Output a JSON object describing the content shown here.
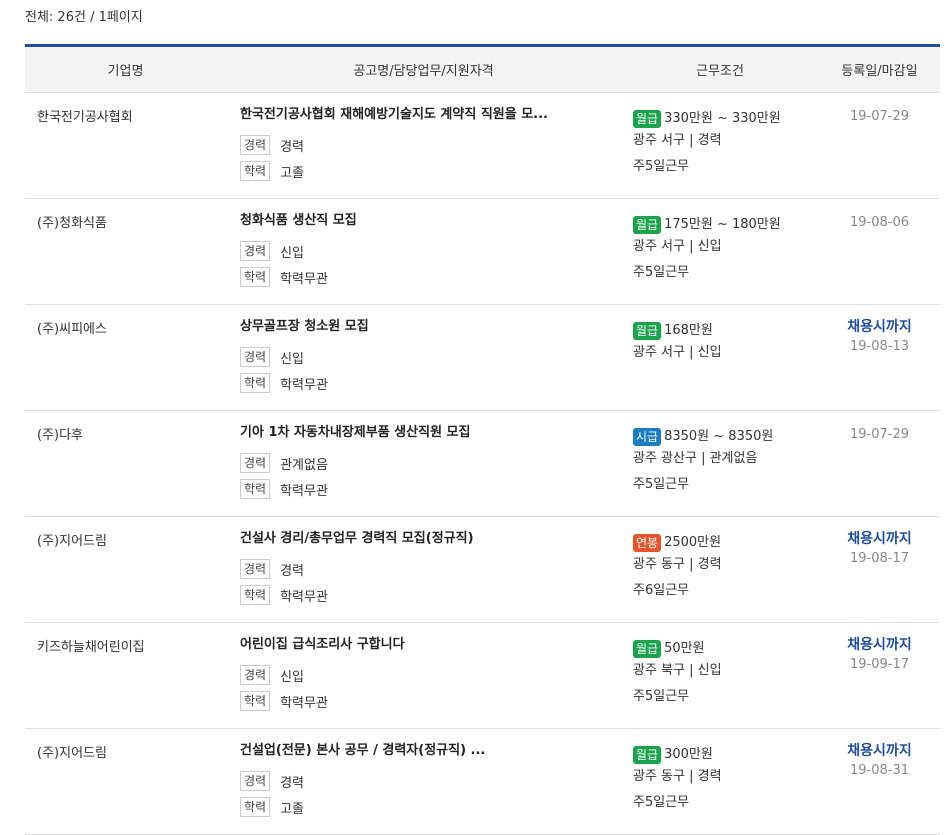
{
  "summary": "전체: 26건 / 1페이지",
  "headers": {
    "company": "기업명",
    "job": "공고명/담당업무/지원자격",
    "conditions": "근무조건",
    "date": "등록일/마감일"
  },
  "labels": {
    "career": "경력",
    "education": "학력"
  },
  "pay_colors": {
    "월급": "#1aa34a",
    "시급": "#1b7cc1",
    "연봉": "#e8552b"
  },
  "rows": [
    {
      "company": "한국전기공사협회",
      "title": "한국전기공사협회 재해예방기술지도 계약직 직원을 모...",
      "career": "경력",
      "education": "고졸",
      "pay_type": "월급",
      "pay_color": "#1aa34a",
      "pay": "330만원 ~ 330만원",
      "location": "광주 서구 | 경력",
      "schedule": "주5일근무",
      "deadline": "",
      "date": "19-07-29"
    },
    {
      "company": "(주)청화식품",
      "title": "청화식품 생산직 모집",
      "career": "신입",
      "education": "학력무관",
      "pay_type": "월급",
      "pay_color": "#1aa34a",
      "pay": "175만원 ~ 180만원",
      "location": "광주 서구 | 신입",
      "schedule": "주5일근무",
      "deadline": "",
      "date": "19-08-06"
    },
    {
      "company": "(주)씨피에스",
      "title": "상무골프장 청소원 모집",
      "career": "신입",
      "education": "학력무관",
      "pay_type": "월급",
      "pay_color": "#1aa34a",
      "pay": "168만원",
      "location": "광주 서구 | 신입",
      "schedule": "",
      "deadline": "채용시까지",
      "date": "19-08-13"
    },
    {
      "company": "(주)다후",
      "title": "기아 1차 자동차내장제부품 생산직원 모집",
      "career": "관계없음",
      "education": "학력무관",
      "pay_type": "시급",
      "pay_color": "#1b7cc1",
      "pay": "8350원 ~ 8350원",
      "location": "광주 광산구 | 관계없음",
      "schedule": "주5일근무",
      "deadline": "",
      "date": "19-07-29"
    },
    {
      "company": "(주)지어드림",
      "title": "건설사 경리/총무업무 경력직 모집(정규직)",
      "career": "경력",
      "education": "학력무관",
      "pay_type": "연봉",
      "pay_color": "#e8552b",
      "pay": "2500만원",
      "location": "광주 동구 | 경력",
      "schedule": "주6일근무",
      "deadline": "채용시까지",
      "date": "19-08-17"
    },
    {
      "company": "키즈하늘채어린이집",
      "title": "어린이집 급식조리사 구합니다",
      "career": "신입",
      "education": "학력무관",
      "pay_type": "월급",
      "pay_color": "#1aa34a",
      "pay": "50만원",
      "location": "광주 북구 | 신입",
      "schedule": "주5일근무",
      "deadline": "채용시까지",
      "date": "19-09-17"
    },
    {
      "company": "(주)지어드림",
      "title": "건설업(전문) 본사 공무 / 경력자(정규직) ...",
      "career": "경력",
      "education": "고졸",
      "pay_type": "월급",
      "pay_color": "#1aa34a",
      "pay": "300만원",
      "location": "광주 동구 | 경력",
      "schedule": "주5일근무",
      "deadline": "채용시까지",
      "date": "19-08-31"
    }
  ]
}
